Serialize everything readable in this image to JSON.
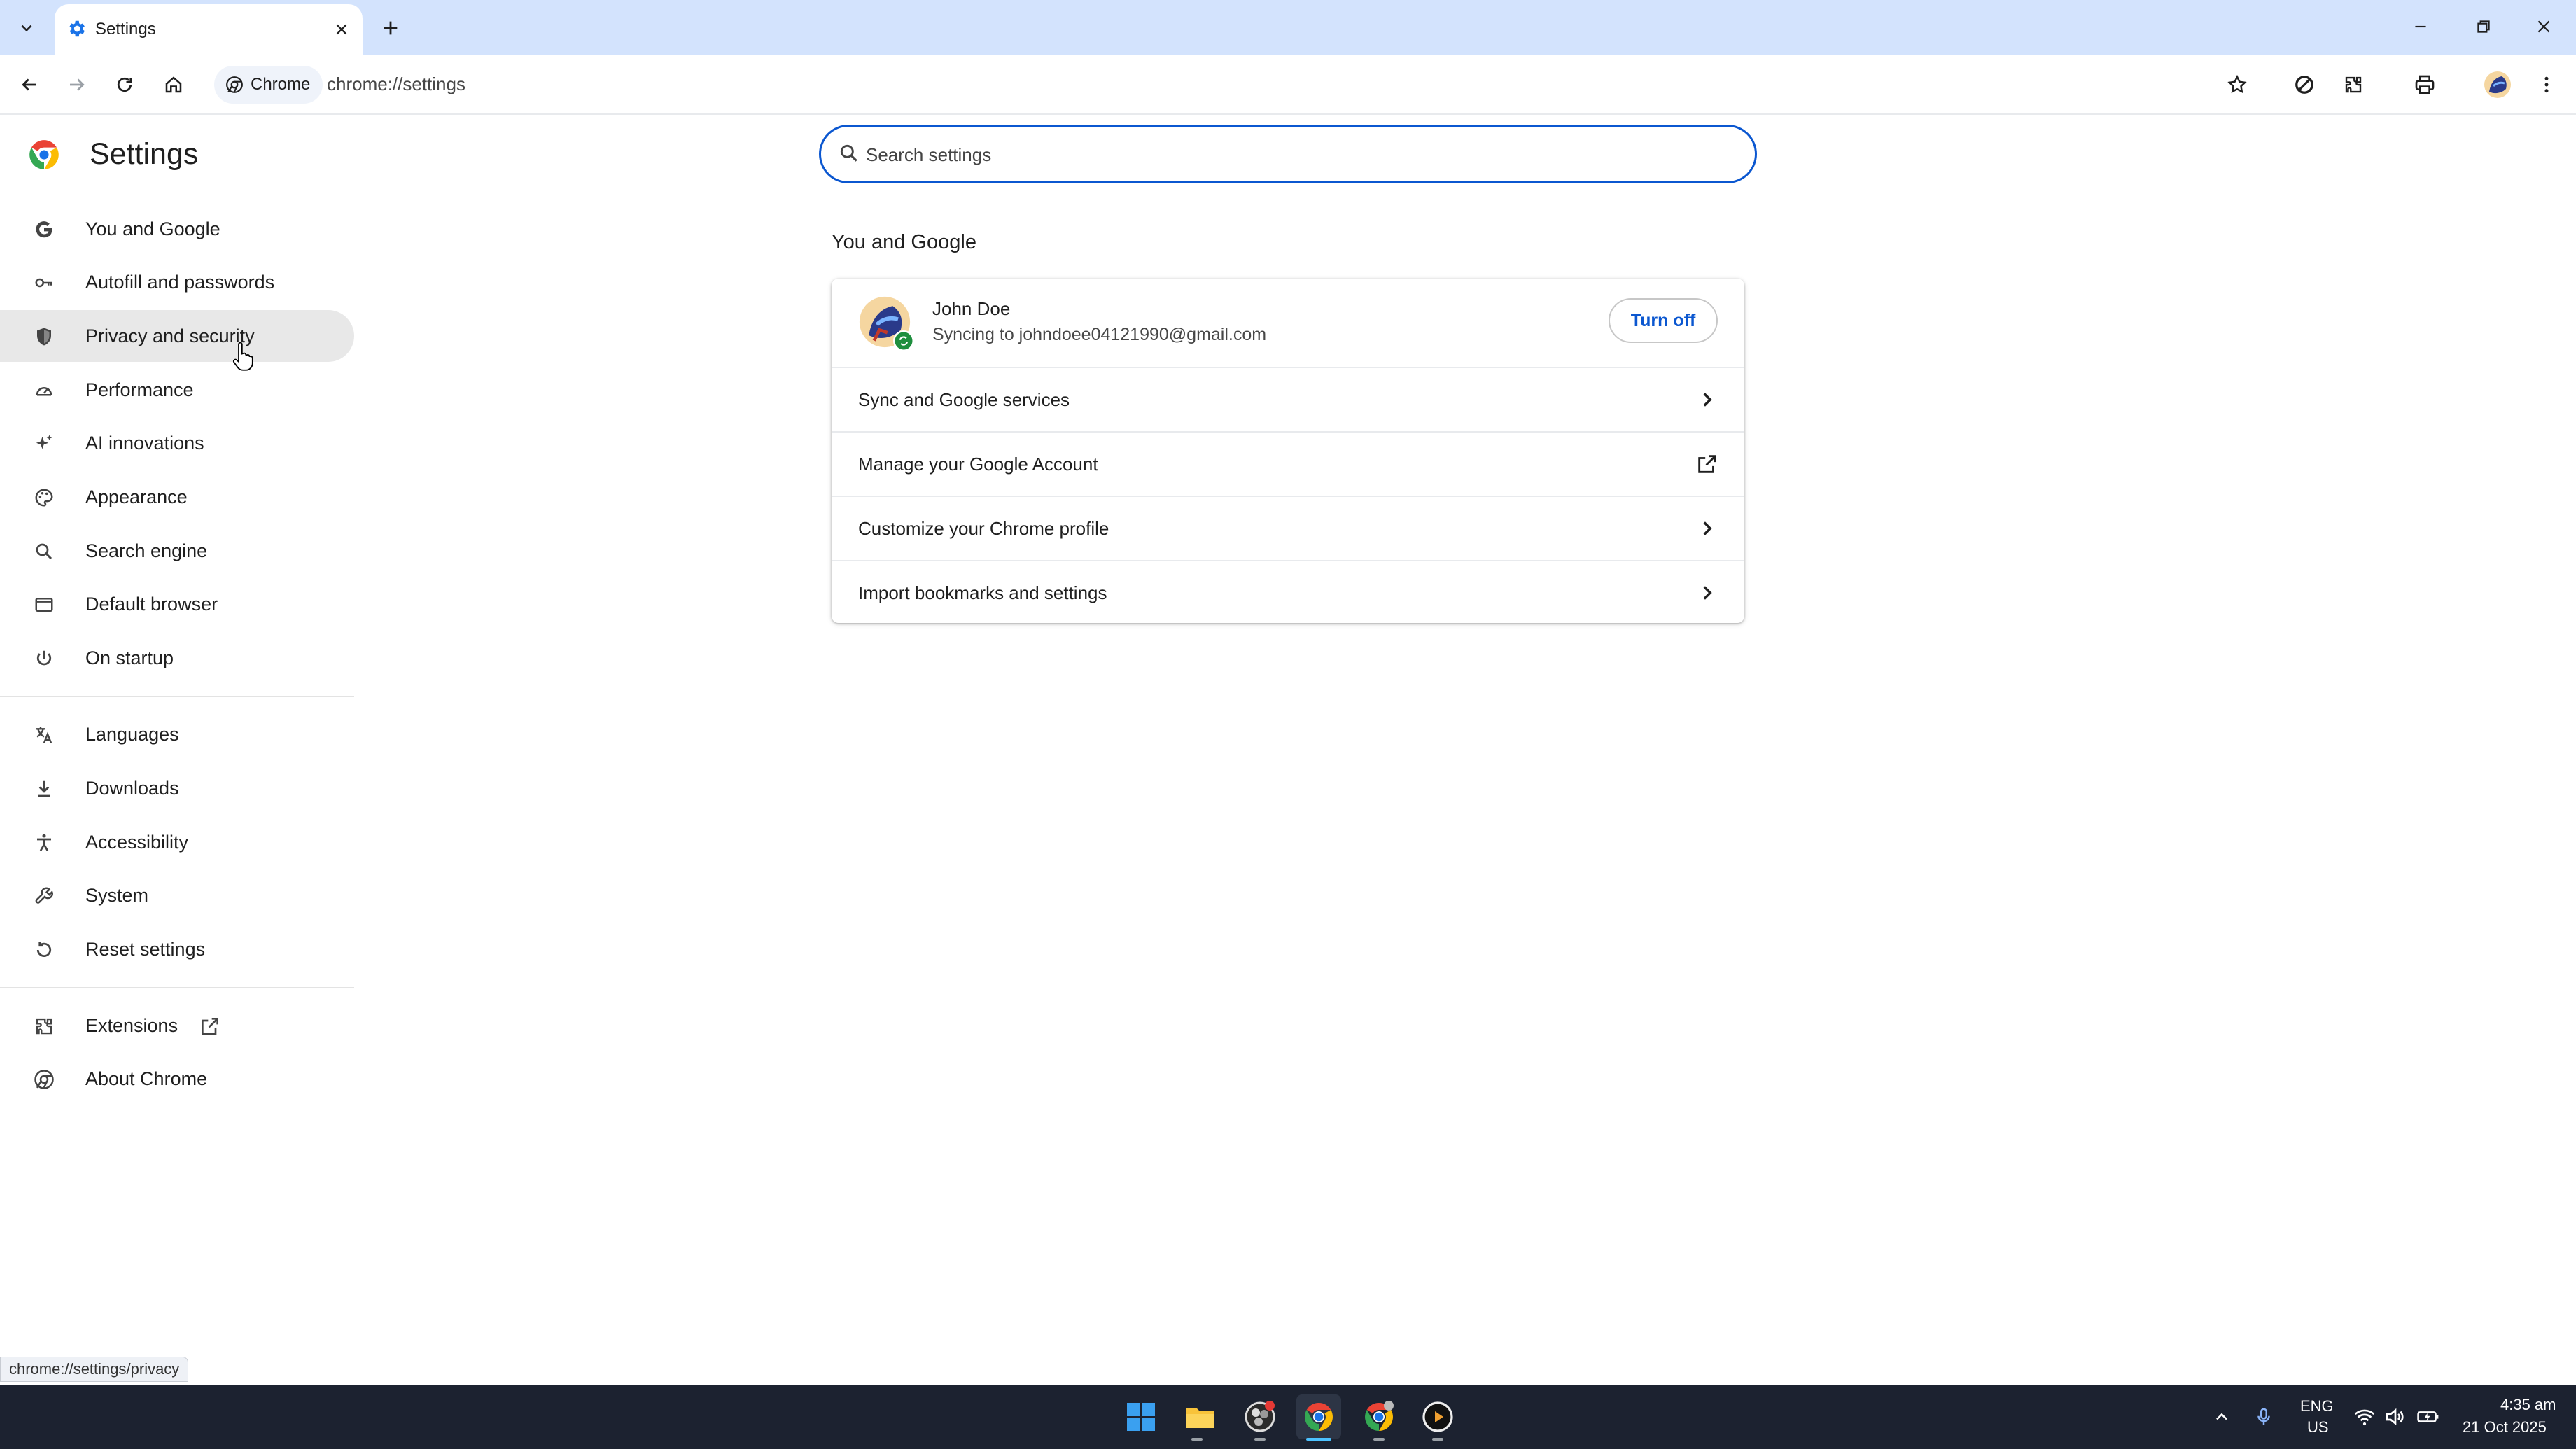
{
  "browser": {
    "tab_title": "Settings",
    "chip_label": "Chrome",
    "url": "chrome://settings",
    "status_url": "chrome://settings/privacy"
  },
  "settings": {
    "title": "Settings",
    "search_placeholder": "Search settings",
    "nav_group1": [
      {
        "label": "You and Google",
        "icon": "google-g-icon"
      },
      {
        "label": "Autofill and passwords",
        "icon": "key-icon"
      },
      {
        "label": "Privacy and security",
        "icon": "shield-icon"
      },
      {
        "label": "Performance",
        "icon": "speedometer-icon"
      },
      {
        "label": "AI innovations",
        "icon": "sparkle-icon"
      },
      {
        "label": "Appearance",
        "icon": "palette-icon"
      },
      {
        "label": "Search engine",
        "icon": "search-icon"
      },
      {
        "label": "Default browser",
        "icon": "browser-window-icon"
      },
      {
        "label": "On startup",
        "icon": "power-icon"
      }
    ],
    "nav_group2": [
      {
        "label": "Languages",
        "icon": "translate-icon"
      },
      {
        "label": "Downloads",
        "icon": "download-icon"
      },
      {
        "label": "Accessibility",
        "icon": "accessibility-icon"
      },
      {
        "label": "System",
        "icon": "wrench-icon"
      },
      {
        "label": "Reset settings",
        "icon": "reset-icon"
      }
    ],
    "nav_group3": [
      {
        "label": "Extensions",
        "icon": "puzzle-icon"
      },
      {
        "label": "About Chrome",
        "icon": "chrome-icon"
      }
    ],
    "section_title": "You and Google",
    "account": {
      "name": "John Doe",
      "sync_text": "Syncing to johndoee04121990@gmail.com",
      "turn_off_label": "Turn off"
    },
    "rows": [
      {
        "label": "Sync and Google services",
        "action": "chevron-right-icon"
      },
      {
        "label": "Manage your Google Account",
        "action": "external-link-icon"
      },
      {
        "label": "Customize your Chrome profile",
        "action": "chevron-right-icon"
      },
      {
        "label": "Import bookmarks and settings",
        "action": "chevron-right-icon"
      }
    ]
  },
  "taskbar": {
    "lang_top": "ENG",
    "lang_bottom": "US",
    "time": "4:35 am",
    "date": "21 Oct 2025"
  },
  "colors": {
    "titlebar": "#d3e3fd",
    "accent": "#0b57d0",
    "active_nav": "#e8e8e8",
    "taskbar": "#1c2230"
  }
}
